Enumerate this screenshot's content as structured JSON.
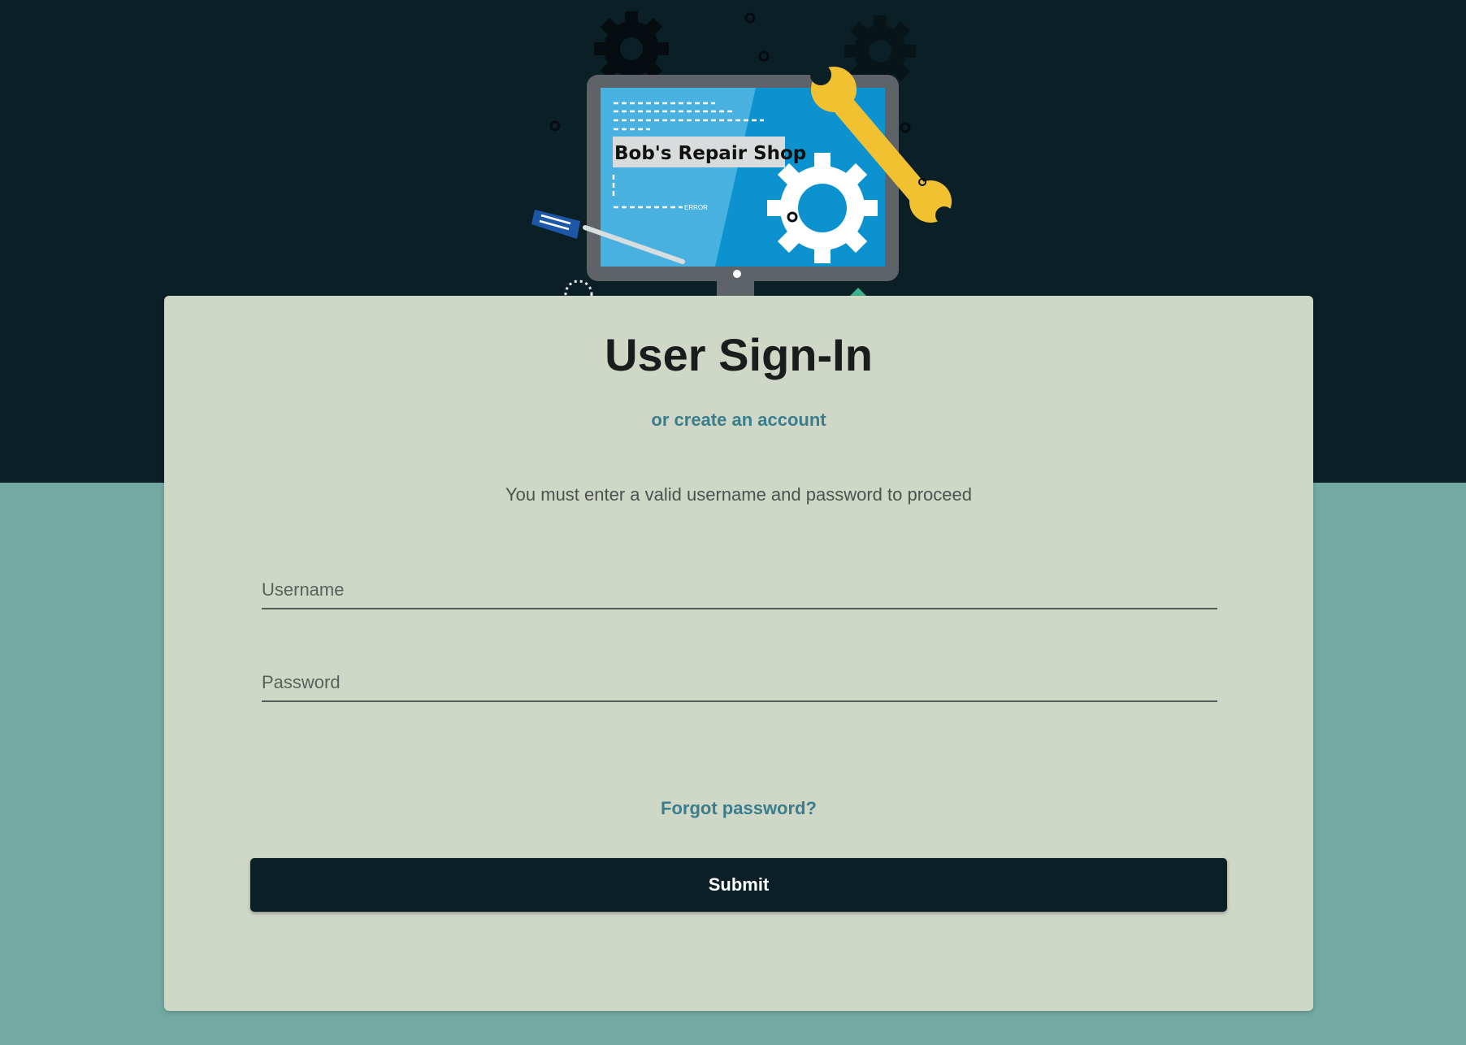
{
  "hero": {
    "shop_name": "Bob's Repair Shop",
    "screen_status": "ERROR"
  },
  "signin": {
    "title": "User Sign-In",
    "create_account_link": "or create an account",
    "notice": "You must enter a valid username and password to proceed",
    "username": {
      "placeholder": "Username",
      "value": ""
    },
    "password": {
      "placeholder": "Password",
      "value": ""
    },
    "forgot_password_link": "Forgot password?",
    "submit_label": "Submit"
  },
  "colors": {
    "top_band": "#0b1f26",
    "bottom_band": "#72a9a2",
    "card": "#cfd7c7",
    "link": "#3a7d8c",
    "button": "#0b1f26",
    "monitor_screen": "#48b1e0",
    "wrench": "#f2c132",
    "screwdriver": "#1d58a8"
  }
}
